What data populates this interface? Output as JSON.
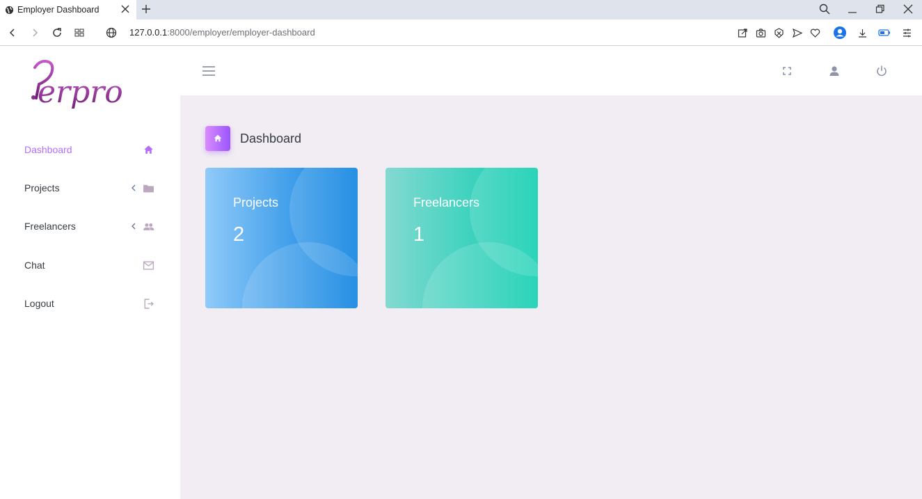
{
  "browser": {
    "tab_title": "Employer Dashboard",
    "url_host": "127.0.0.1",
    "url_path": ":8000/employer/employer-dashboard"
  },
  "brand": {
    "logo_text": "?erpro"
  },
  "sidebar": {
    "items": [
      {
        "label": "Dashboard",
        "icon": "home-icon",
        "active": true
      },
      {
        "label": "Projects",
        "icon": "folder-icon",
        "expandable": true
      },
      {
        "label": "Freelancers",
        "icon": "users-icon",
        "expandable": true
      },
      {
        "label": "Chat",
        "icon": "mail-icon"
      },
      {
        "label": "Logout",
        "icon": "logout-icon"
      }
    ]
  },
  "page": {
    "title": "Dashboard",
    "icon": "home-icon"
  },
  "cards": [
    {
      "title": "Projects",
      "value": "2",
      "color": "#047edf"
    },
    {
      "title": "Freelancers",
      "value": "1",
      "color": "#07cdae"
    }
  ],
  "colors": {
    "accent": "#b66dff",
    "content_bg": "#f2edf3"
  }
}
